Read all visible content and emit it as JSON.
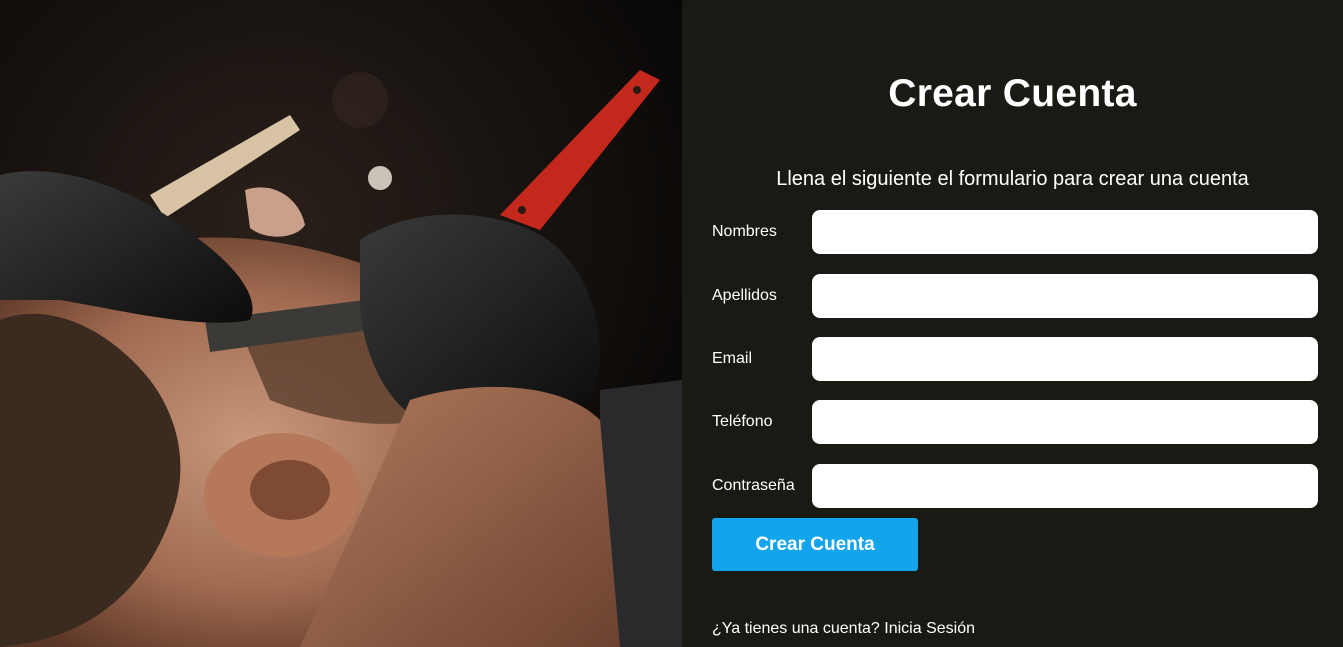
{
  "form": {
    "title": "Crear Cuenta",
    "subtitle": "Llena el siguiente el formulario para crear una cuenta",
    "fields": [
      {
        "label": "Nombres",
        "value": "",
        "type": "text"
      },
      {
        "label": "Apellidos",
        "value": "",
        "type": "text"
      },
      {
        "label": "Email",
        "value": "",
        "type": "email"
      },
      {
        "label": "Teléfono",
        "value": "",
        "type": "tel"
      },
      {
        "label": "Contraseña",
        "value": "",
        "type": "password"
      }
    ],
    "submit_label": "Crear Cuenta",
    "login_prompt": "¿Ya tienes una cuenta?",
    "login_link": "Inicia Sesión"
  },
  "colors": {
    "panel_background": "#1a1a15",
    "button": "#12a4ec",
    "text": "#ffffff"
  },
  "icons": {
    "hero_image": "barber-shaving-photo"
  }
}
